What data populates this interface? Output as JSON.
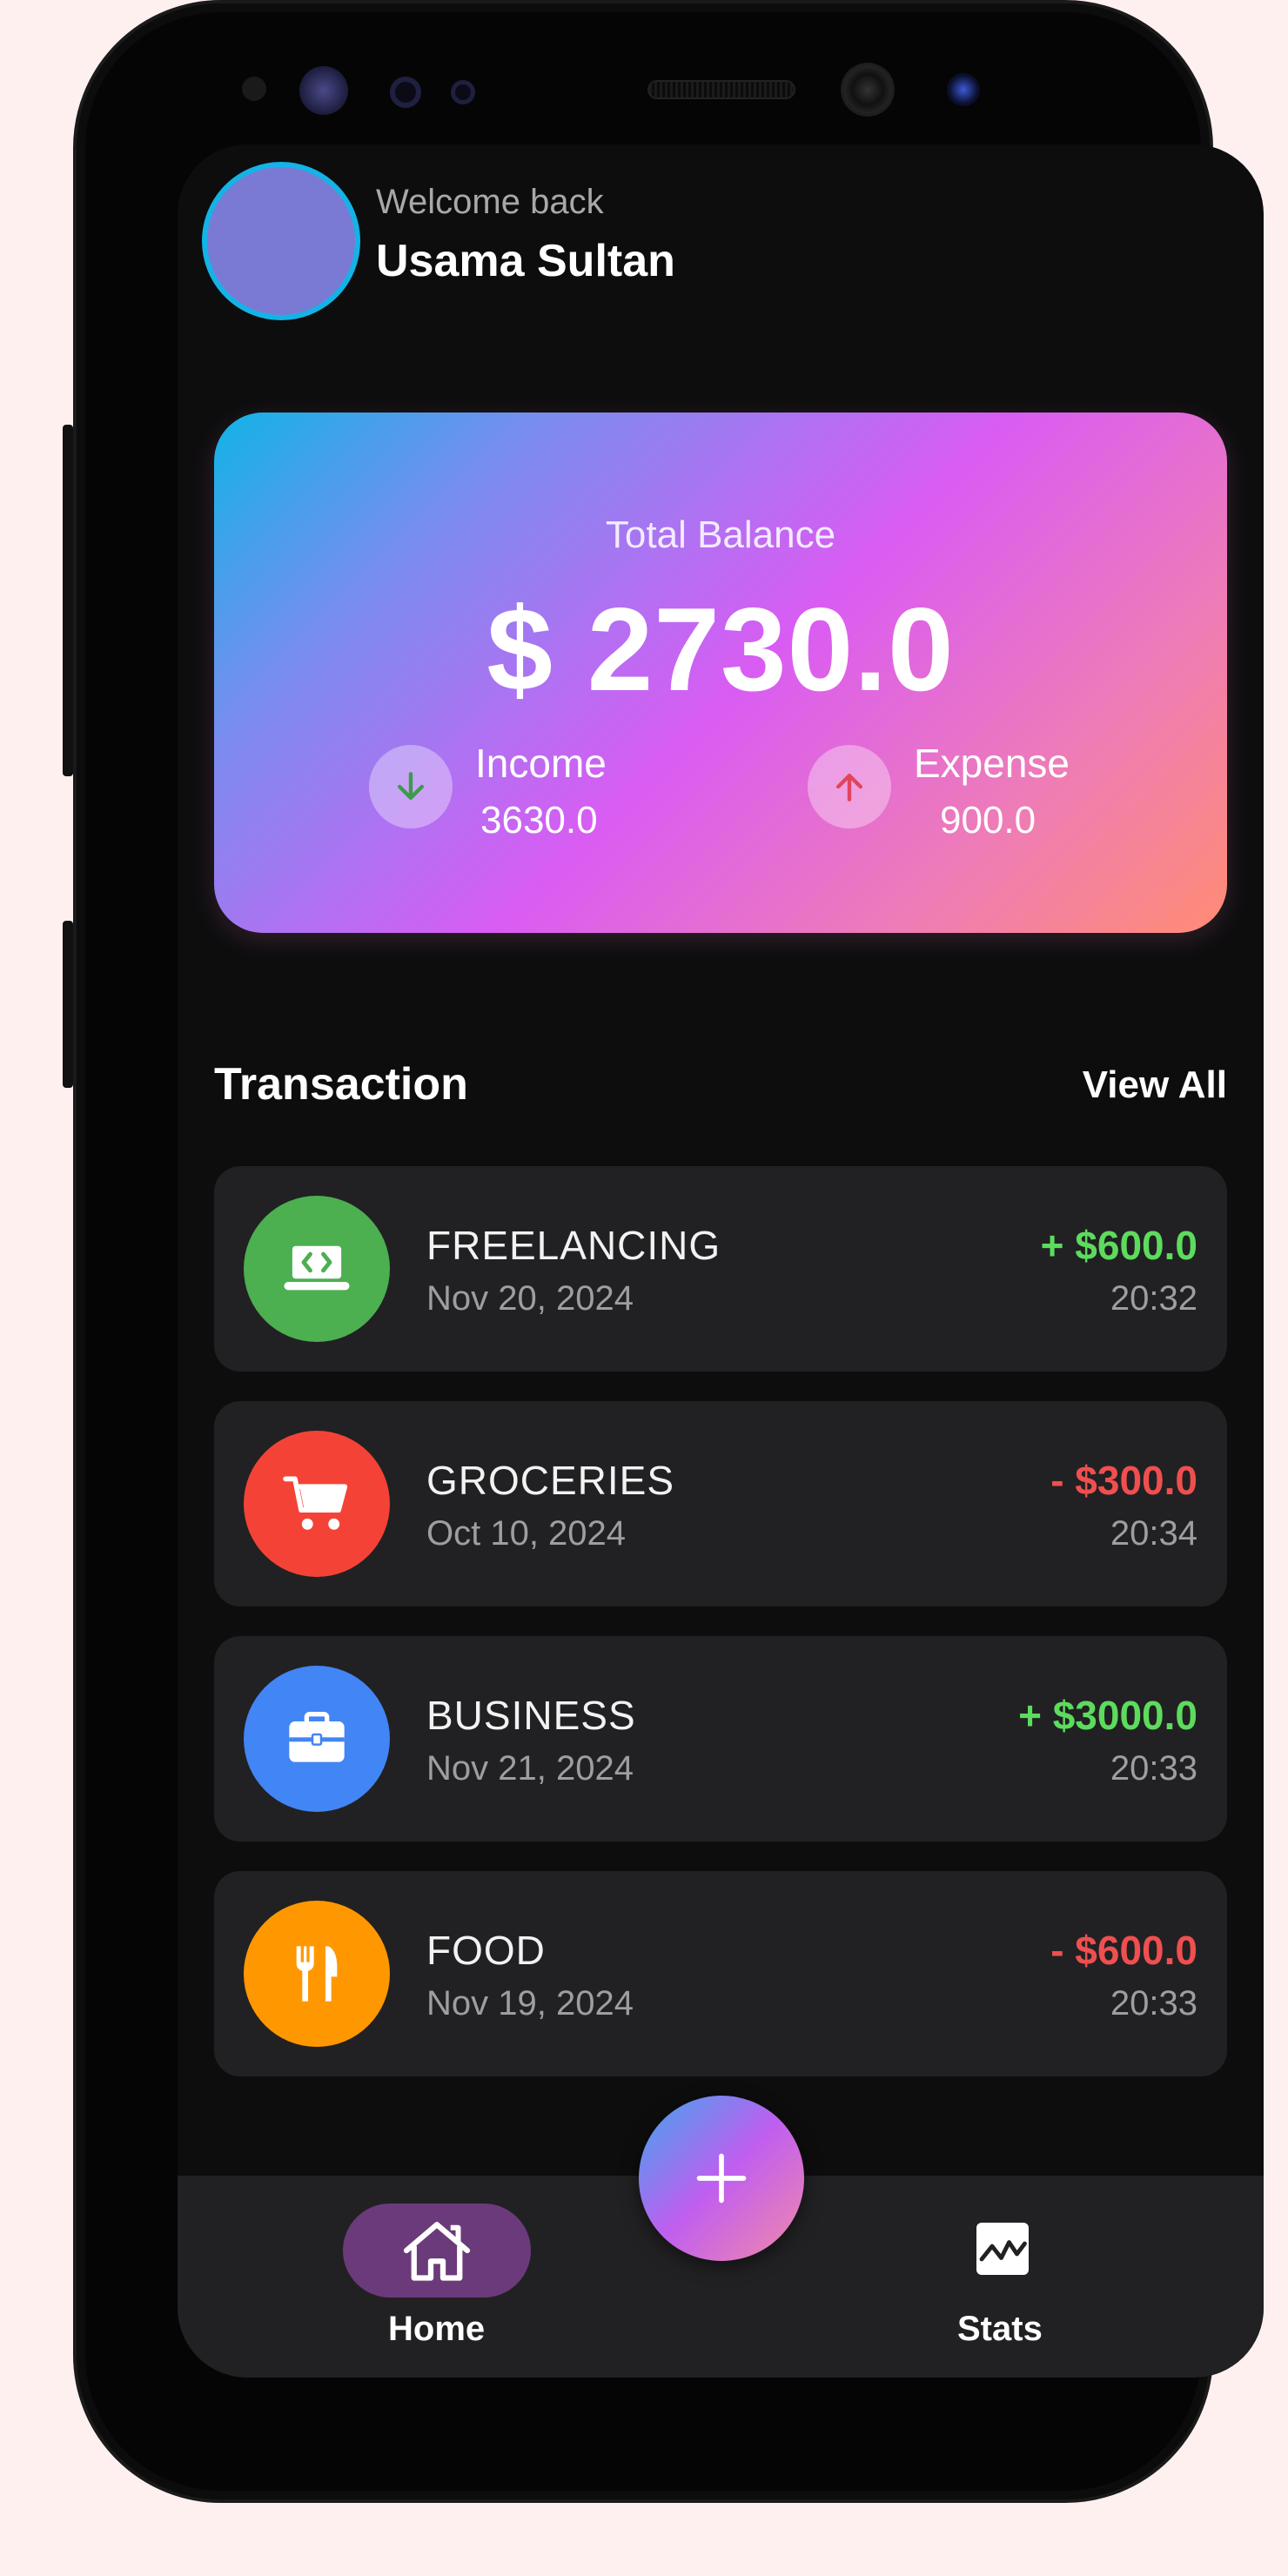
{
  "header": {
    "welcome_text": "Welcome back",
    "user_name": "Usama Sultan"
  },
  "balance_card": {
    "label": "Total Balance",
    "amount": "$ 2730.0",
    "income_label": "Income",
    "income_value": "3630.0",
    "expense_label": "Expense",
    "expense_value": "900.0"
  },
  "transactions": {
    "title": "Transaction",
    "view_all_label": "View All",
    "items": [
      {
        "name": "FREELANCING",
        "date": "Nov 20, 2024",
        "amount": "+ $600.0",
        "time": "20:32",
        "icon": "laptop-code-icon",
        "icon_color": "#4caf50",
        "amount_color": "#5ddb5d"
      },
      {
        "name": "GROCERIES",
        "date": "Oct 10, 2024",
        "amount": "- $300.0",
        "time": "20:34",
        "icon": "cart-icon",
        "icon_color": "#f44336",
        "amount_color": "#ef4f4f"
      },
      {
        "name": "BUSINESS",
        "date": "Nov 21, 2024",
        "amount": "+ $3000.0",
        "time": "20:33",
        "icon": "briefcase-icon",
        "icon_color": "#4285f4",
        "amount_color": "#5ddb5d"
      },
      {
        "name": "FOOD",
        "date": "Nov 19, 2024",
        "amount": "- $600.0",
        "time": "20:33",
        "icon": "utensils-icon",
        "icon_color": "#ff9800",
        "amount_color": "#ef4f4f"
      }
    ]
  },
  "nav": {
    "home_label": "Home",
    "stats_label": "Stats"
  },
  "colors": {
    "background": "#0d0d0e",
    "card_surface": "#212123",
    "income_green": "#5ddb5d",
    "expense_red": "#ef4f4f",
    "nav_active": "#6b3a7a"
  }
}
